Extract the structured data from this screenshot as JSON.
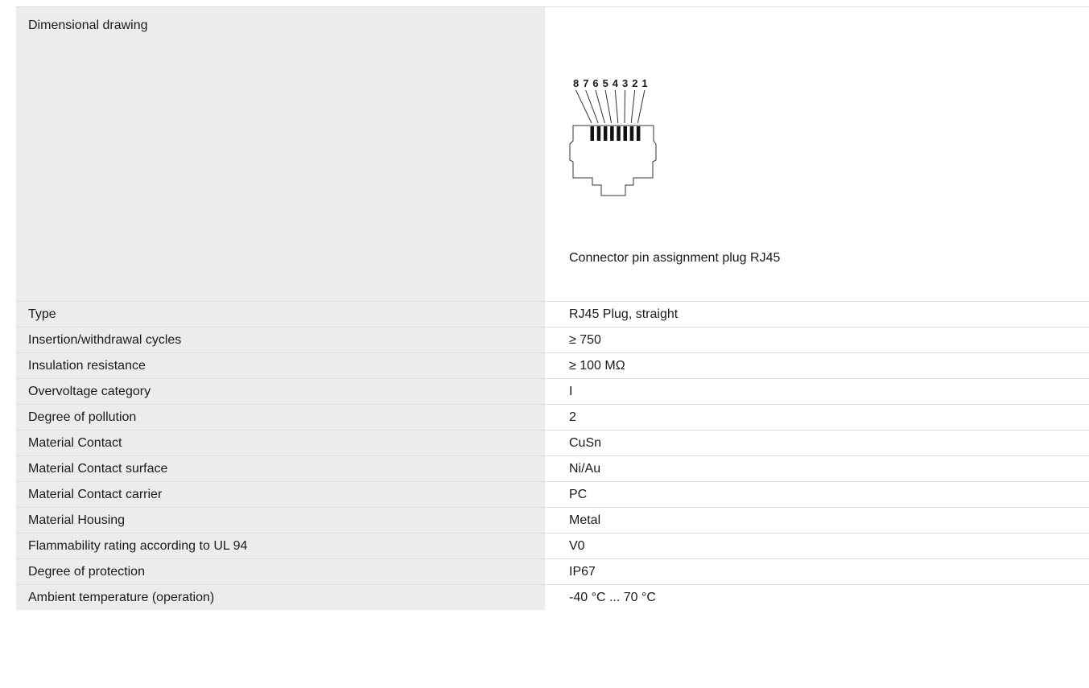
{
  "drawing": {
    "label": "Dimensional drawing",
    "caption": "Connector pin assignment plug RJ45",
    "pin_labels": [
      "8",
      "7",
      "6",
      "5",
      "4",
      "3",
      "2",
      "1"
    ]
  },
  "specs": [
    {
      "label": "Type",
      "value": "RJ45 Plug, straight"
    },
    {
      "label": "Insertion/withdrawal cycles",
      "value": "≥ 750"
    },
    {
      "label": "Insulation resistance",
      "value": "≥ 100 MΩ"
    },
    {
      "label": "Overvoltage category",
      "value": "I"
    },
    {
      "label": "Degree of pollution",
      "value": "2"
    },
    {
      "label": "Material Contact",
      "value": "CuSn"
    },
    {
      "label": "Material Contact surface",
      "value": "Ni/Au"
    },
    {
      "label": "Material Contact carrier",
      "value": "PC"
    },
    {
      "label": "Material Housing",
      "value": "Metal"
    },
    {
      "label": "Flammability rating according to UL 94",
      "value": "V0"
    },
    {
      "label": "Degree of protection",
      "value": "IP67"
    },
    {
      "label": "Ambient temperature (operation)",
      "value": "-40 °C ... 70 °C"
    }
  ]
}
